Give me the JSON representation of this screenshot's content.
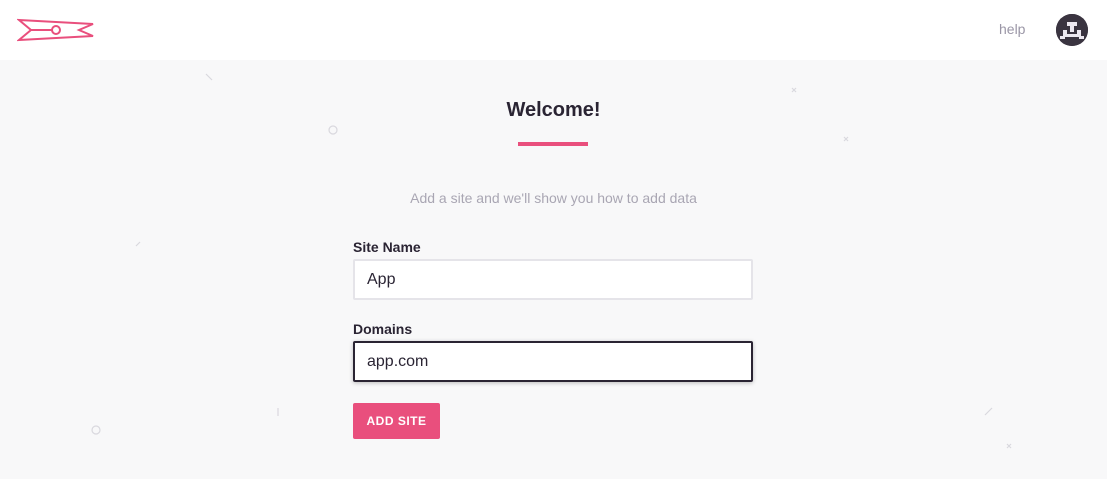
{
  "header": {
    "help_label": "help",
    "logo_icon": "clothespin-logo-icon",
    "avatar_icon": "user-avatar-icon"
  },
  "main": {
    "title": "Welcome!",
    "subtitle": "Add a site and we'll show you how to add data",
    "site_name": {
      "label": "Site Name",
      "value": "App"
    },
    "domains": {
      "label": "Domains",
      "value": "app.com"
    },
    "submit_label": "ADD SITE"
  },
  "colors": {
    "accent": "#e94f7d",
    "text_dark": "#2a2433",
    "text_muted": "#a9a6b3",
    "background": "#f8f8f9"
  }
}
